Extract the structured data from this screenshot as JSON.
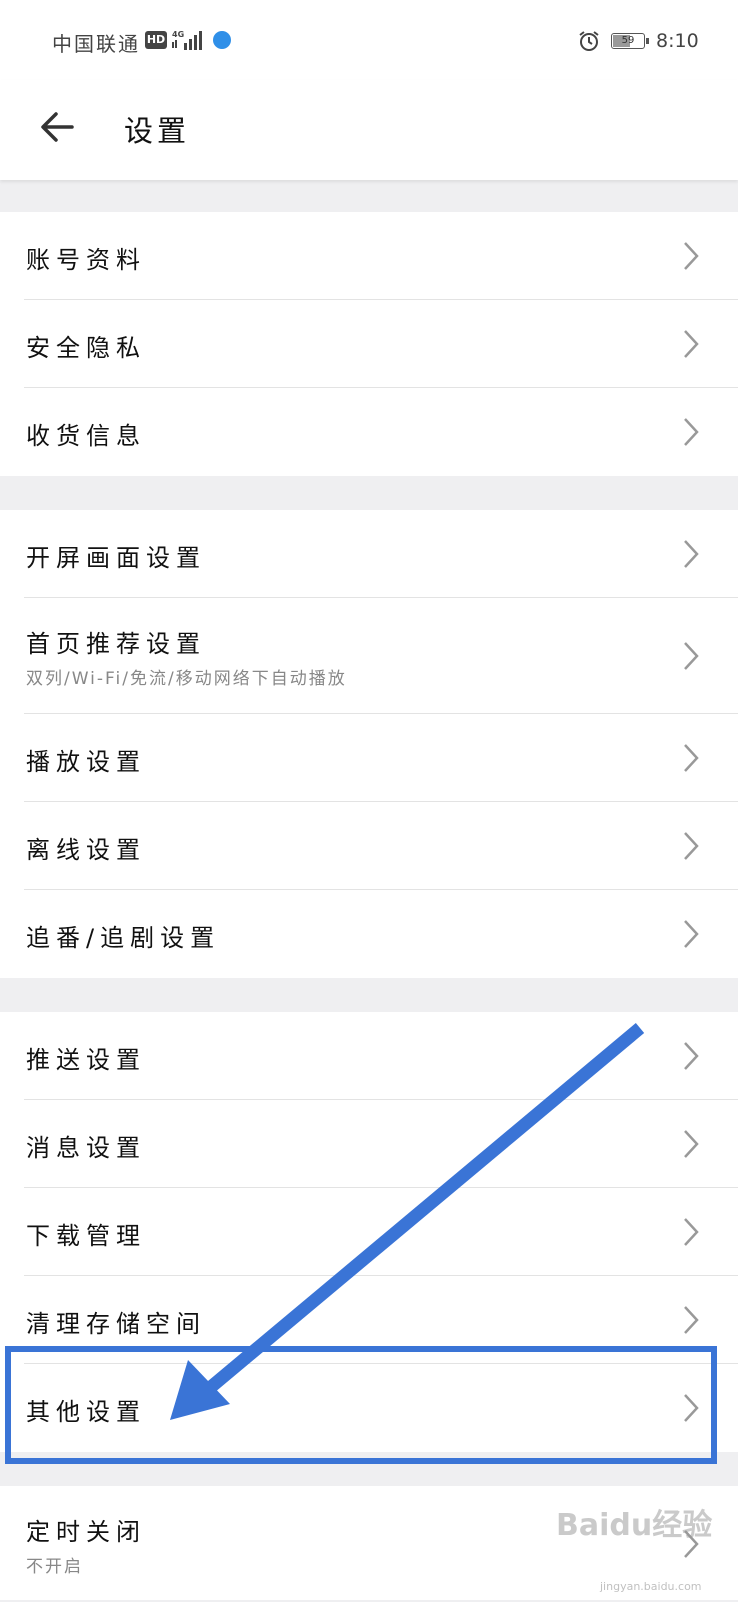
{
  "status_bar": {
    "carrier": "中国联通",
    "hd_badge": "HD",
    "battery": "59",
    "time": "8:10",
    "icons": [
      "hd-icon",
      "signal-4g-icon",
      "app-notification-icon",
      "alarm-icon",
      "battery-icon"
    ]
  },
  "header": {
    "title": "设置",
    "back_icon": "arrow-left-icon"
  },
  "groups": [
    {
      "items": [
        {
          "label": "账号资料"
        },
        {
          "label": "安全隐私"
        },
        {
          "label": "收货信息"
        }
      ]
    },
    {
      "items": [
        {
          "label": "开屏画面设置"
        },
        {
          "label": "首页推荐设置",
          "sub": "双列/Wi-Fi/免流/移动网络下自动播放"
        },
        {
          "label": "播放设置"
        },
        {
          "label": "离线设置"
        },
        {
          "label": "追番/追剧设置"
        }
      ]
    },
    {
      "items": [
        {
          "label": "推送设置"
        },
        {
          "label": "消息设置"
        },
        {
          "label": "下载管理"
        },
        {
          "label": "清理存储空间"
        },
        {
          "label": "其他设置"
        }
      ]
    },
    {
      "items": [
        {
          "label": "定时关闭",
          "sub": "不开启"
        }
      ]
    }
  ],
  "annotation": {
    "highlight_color": "#3a74d6",
    "arrow_color": "#3a74d6"
  },
  "watermark": {
    "text": "Baidu经验",
    "url": "jingyan.baidu.com"
  }
}
